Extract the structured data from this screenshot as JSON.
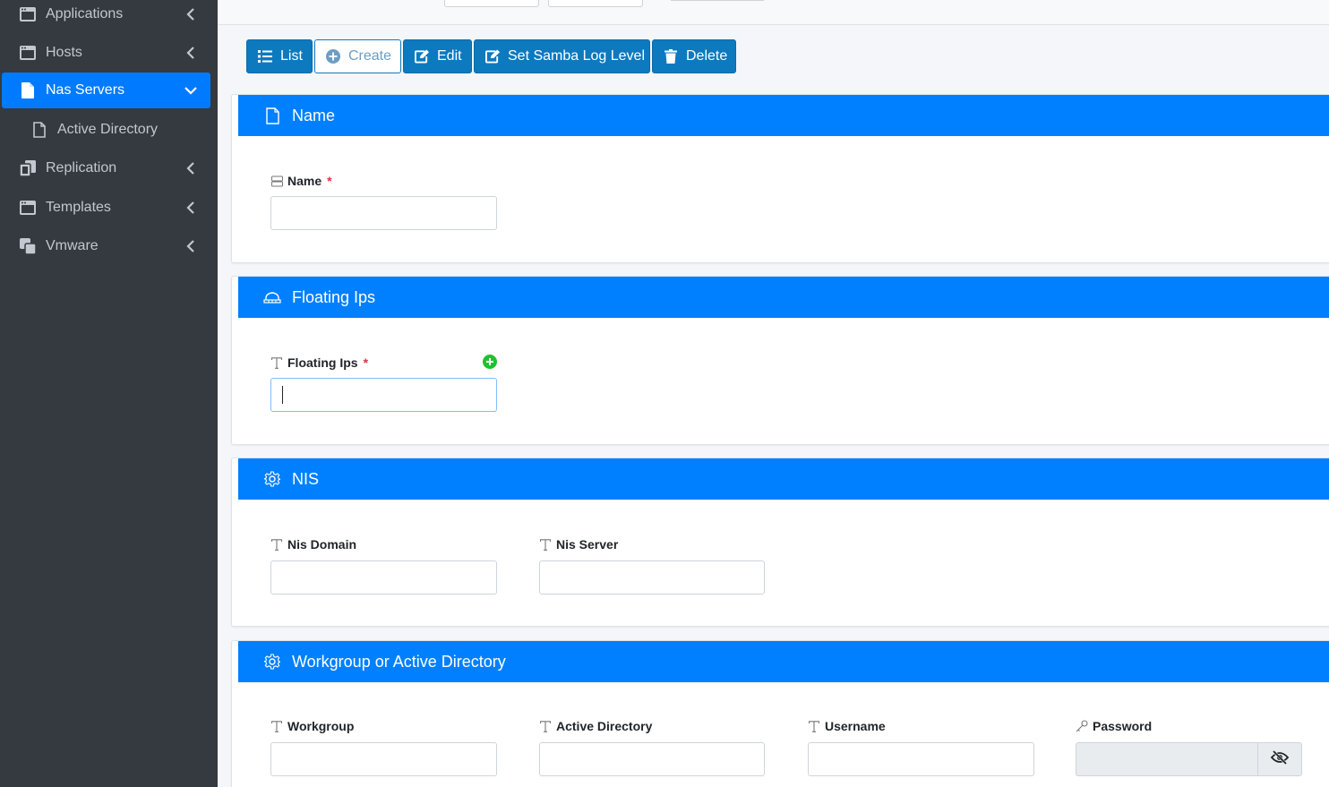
{
  "sidebar": {
    "items": [
      {
        "label": "Applications",
        "icon": "window-icon"
      },
      {
        "label": "Hosts",
        "icon": "window-icon"
      },
      {
        "label": "Nas Servers",
        "icon": "file-icon",
        "active": true
      },
      {
        "label": "Active Directory",
        "icon": "file-outline-icon"
      },
      {
        "label": "Replication",
        "icon": "copy-icon"
      },
      {
        "label": "Templates",
        "icon": "window-icon"
      },
      {
        "label": "Vmware",
        "icon": "clone-icon"
      }
    ]
  },
  "toolbar": {
    "list_label": "List",
    "create_label": "Create",
    "edit_label": "Edit",
    "samba_label": "Set Samba Log Level",
    "delete_label": "Delete"
  },
  "sections": {
    "name": {
      "title": "Name",
      "fields": {
        "name": {
          "label": "Name",
          "required": "*",
          "value": ""
        }
      }
    },
    "floating": {
      "title": "Floating Ips",
      "fields": {
        "floating_ips": {
          "label": "Floating Ips",
          "required": "*",
          "value": ""
        }
      }
    },
    "nis": {
      "title": "NIS",
      "fields": {
        "nis_domain": {
          "label": "Nis Domain",
          "value": ""
        },
        "nis_server": {
          "label": "Nis Server",
          "value": ""
        }
      }
    },
    "workgroup": {
      "title": "Workgroup or Active Directory",
      "fields": {
        "workgroup": {
          "label": "Workgroup",
          "value": ""
        },
        "active_directory": {
          "label": "Active Directory",
          "value": ""
        },
        "username": {
          "label": "Username",
          "value": ""
        },
        "password": {
          "label": "Password",
          "value": ""
        }
      }
    }
  },
  "colors": {
    "sidebar_bg": "#343a40",
    "sidebar_active": "#007bff",
    "section_header": "#0080ff",
    "button_primary": "#0d7abf",
    "required": "#dc3545",
    "add_button": "#22c032"
  }
}
